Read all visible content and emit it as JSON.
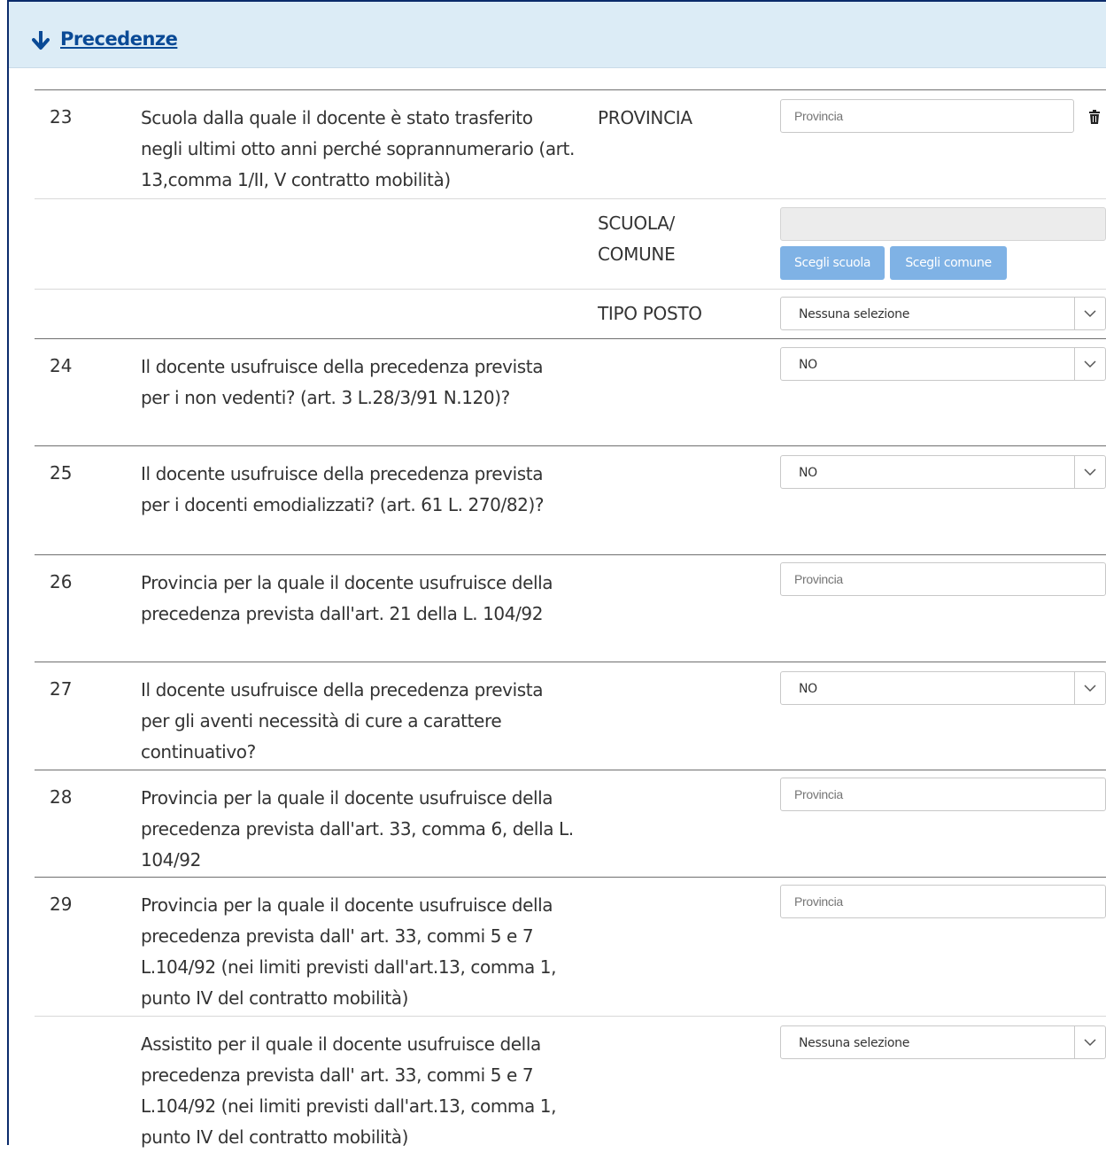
{
  "section": {
    "title": "Precedenze"
  },
  "rows": [
    {
      "num": "23",
      "desc": "Scuola dalla quale il docente è stato trasferito negli ultimi otto anni perché soprannumerario (art. 13,comma 1/II, V contratto mobilità)",
      "provincia_label": "PROVINCIA",
      "provincia_placeholder": "Provincia",
      "scuola_label_1": "SCUOLA/",
      "scuola_label_2": "COMUNE",
      "scuola_value": "",
      "btn_scuola": "Scegli scuola",
      "btn_comune": "Scegli comune",
      "tipo_posto_label": "TIPO POSTO",
      "tipo_posto_value": "Nessuna selezione"
    },
    {
      "num": "24",
      "desc": "Il docente usufruisce della precedenza prevista per i non vedenti? (art. 3 L.28/3/91 N.120)?",
      "value": "NO"
    },
    {
      "num": "25",
      "desc": "Il docente usufruisce della precedenza prevista per i docenti emodializzati? (art. 61 L. 270/82)?",
      "value": "NO"
    },
    {
      "num": "26",
      "desc": "Provincia per la quale il docente usufruisce della precedenza prevista dall'art. 21 della L. 104/92",
      "placeholder": "Provincia"
    },
    {
      "num": "27",
      "desc": "Il docente usufruisce della precedenza prevista per gli aventi necessità di cure a carattere continuativo?",
      "value": "NO"
    },
    {
      "num": "28",
      "desc": "Provincia per la quale il docente usufruisce della precedenza prevista dall'art. 33, comma 6, della L. 104/92",
      "placeholder": "Provincia"
    },
    {
      "num": "29",
      "desc": "Provincia per la quale il docente usufruisce della precedenza prevista dall' art. 33, commi 5 e 7 L.104/92 (nei limiti previsti dall'art.13, comma 1, punto IV del contratto mobilità)",
      "placeholder": "Provincia"
    },
    {
      "num": "",
      "desc": "Assistito per il quale il docente usufruisce della precedenza prevista dall' art. 33, commi 5 e 7 L.104/92 (nei limiti previsti dall'art.13, comma 1, punto IV del contratto mobilità)",
      "value": "Nessuna selezione"
    }
  ],
  "icons": {
    "section_toggle": "arrow-down-icon",
    "delete": "trash-icon",
    "dropdown": "chevron-down-icon"
  },
  "colors": {
    "header_bg": "#dcecf6",
    "link": "#0a4a96",
    "button": "#7fb2e5"
  }
}
